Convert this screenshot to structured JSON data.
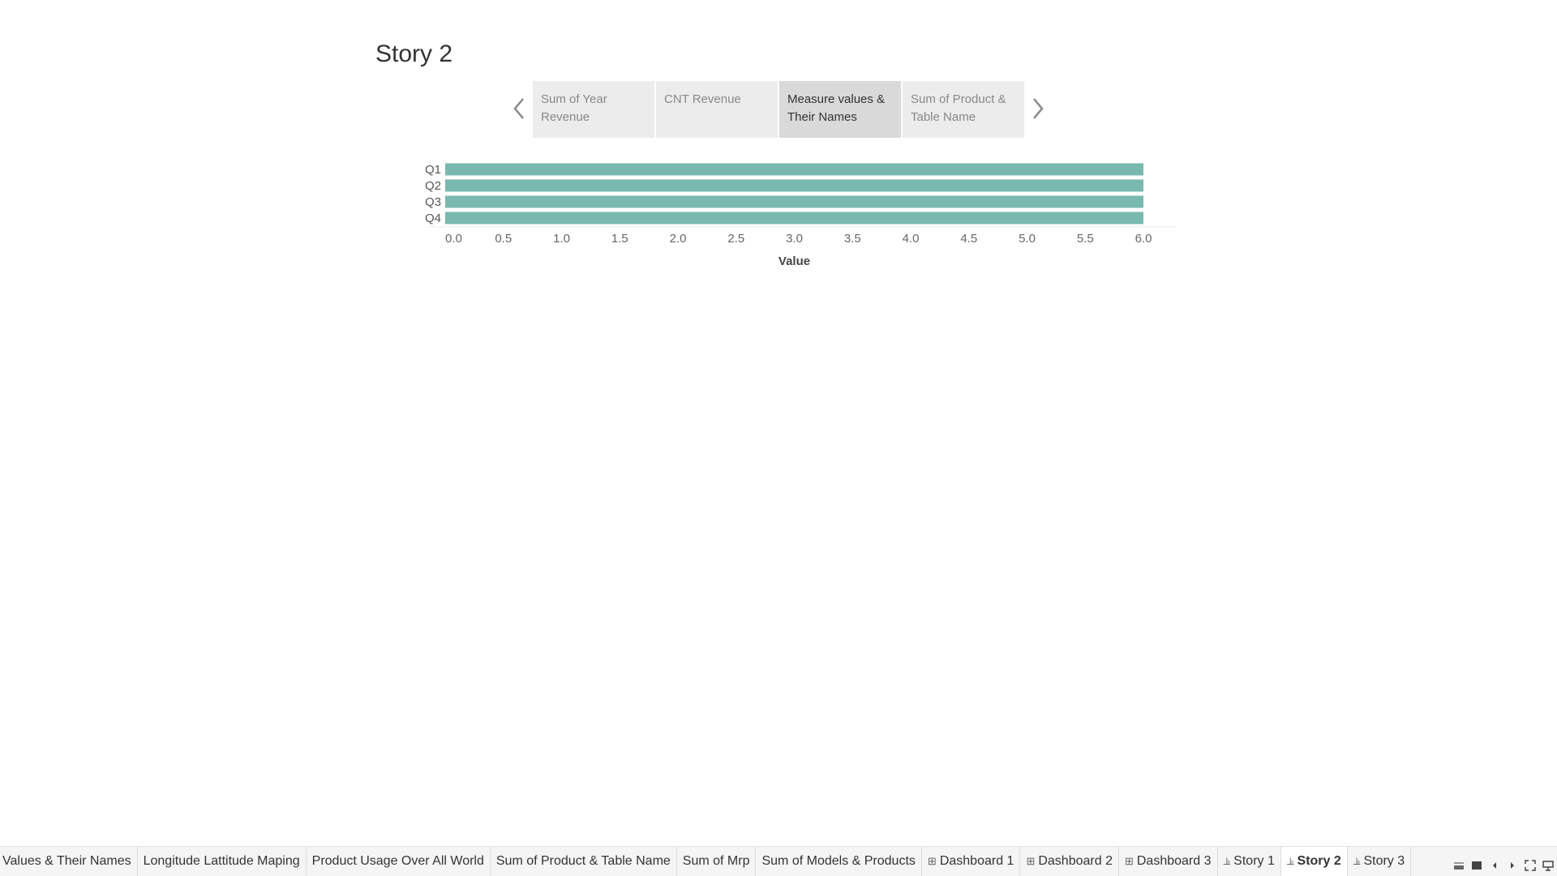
{
  "story": {
    "title": "Story 2",
    "points": [
      {
        "label": "Sum of Year Revenue",
        "active": false
      },
      {
        "label": "CNT Revenue",
        "active": false
      },
      {
        "label": "Measure values & Their Names",
        "active": true
      },
      {
        "label": "Sum of Product & Table Name",
        "active": false
      }
    ],
    "prev_icon": "chevron-left-icon",
    "next_icon": "chevron-right-icon"
  },
  "chart_data": {
    "type": "bar",
    "orientation": "horizontal",
    "categories": [
      "Q1",
      "Q2",
      "Q3",
      "Q4"
    ],
    "values": [
      6.0,
      6.0,
      6.0,
      6.0
    ],
    "xlabel": "Value",
    "ylabel": "",
    "xlim": [
      0,
      6.0
    ],
    "x_ticks": [
      "0.0",
      "0.5",
      "1.0",
      "1.5",
      "2.0",
      "2.5",
      "3.0",
      "3.5",
      "4.0",
      "4.5",
      "5.0",
      "5.5",
      "6.0"
    ],
    "bar_color": "#79b8ae",
    "grid": false
  },
  "tabs": [
    {
      "label": "Values & Their Names",
      "icon": "",
      "active": false
    },
    {
      "label": "Longitude Lattitude Maping",
      "icon": "",
      "active": false
    },
    {
      "label": "Product Usage  Over All World",
      "icon": "",
      "active": false
    },
    {
      "label": "Sum of Product & Table Name",
      "icon": "",
      "active": false
    },
    {
      "label": "Sum of Mrp",
      "icon": "",
      "active": false
    },
    {
      "label": "Sum of Models & Products",
      "icon": "",
      "active": false
    },
    {
      "label": "Dashboard 1",
      "icon": "dashboard-icon",
      "active": false
    },
    {
      "label": "Dashboard 2",
      "icon": "dashboard-icon",
      "active": false
    },
    {
      "label": "Dashboard 3",
      "icon": "dashboard-icon",
      "active": false
    },
    {
      "label": "Story 1",
      "icon": "story-icon",
      "active": false
    },
    {
      "label": "Story 2",
      "icon": "story-icon",
      "active": true
    },
    {
      "label": "Story 3",
      "icon": "story-icon",
      "active": false
    }
  ],
  "tab_controls": [
    "show-filmstrip-icon",
    "show-tabs-icon",
    "prev-sheet-icon",
    "next-sheet-icon",
    "fullscreen-icon",
    "presentation-icon"
  ]
}
